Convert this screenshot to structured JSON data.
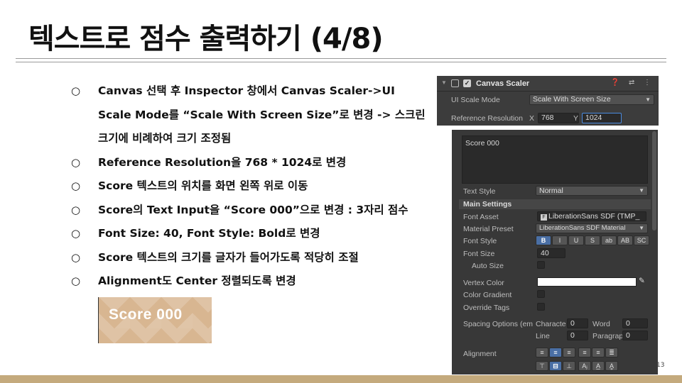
{
  "title": "텍스트로 점수 출력하기 (4/8)",
  "bullet_mark": "○",
  "bullets": [
    [
      "Canvas 선택 후 Inspector 창에서 Canvas Scaler->UI",
      "Scale Mode를 “Scale With Screen Size”로 변경 -> 스크린",
      "크기에 비례하여 크기 조정됨"
    ],
    [
      "Reference Resolution을 768 * 1024로 변경"
    ],
    [
      "Score 텍스트의 위치를 화면 왼쪽 위로 이동"
    ],
    [
      "Score의 Text Input을 “Score 000”으로 변경 : 3자리 점수"
    ],
    [
      "Font Size: 40, Font Style: Bold로 변경"
    ],
    [
      "Score 텍스트의 크기를 글자가 들어가도록 적당히 조절"
    ],
    [
      "Alignment도 Center 정렬되도록 변경"
    ]
  ],
  "preview": {
    "text": "Score 000",
    "bg_color": "#d9b895"
  },
  "canvas_scaler": {
    "name": "Canvas Scaler",
    "header_icons": "❓ ⇄ ⋮",
    "ui_scale_mode_label": "UI Scale Mode",
    "ui_scale_mode_value": "Scale With Screen Size",
    "ref_res_label": "Reference Resolution",
    "x_label": "X",
    "x_value": "768",
    "y_label": "Y",
    "y_value": "1024"
  },
  "tmp": {
    "text_input": "Score 000",
    "text_style_label": "Text Style",
    "text_style_value": "Normal",
    "main_settings": "Main Settings",
    "font_asset_label": "Font Asset",
    "font_asset_value": "LiberationSans SDF (TMP_",
    "material_preset_label": "Material Preset",
    "material_preset_value": "LiberationSans SDF Material",
    "font_style_label": "Font Style",
    "font_style_buttons": [
      "B",
      "I",
      "U",
      "S",
      "ab",
      "AB",
      "SC"
    ],
    "font_size_label": "Font Size",
    "font_size_value": "40",
    "auto_size_label": "Auto Size",
    "vertex_color_label": "Vertex Color",
    "color_gradient_label": "Color Gradient",
    "override_tags_label": "Override Tags",
    "spacing_label": "Spacing Options (em",
    "character_label": "Characte",
    "character_value": "0",
    "word_label": "Word",
    "word_value": "0",
    "line_label": "Line",
    "line_value": "0",
    "paragraph_label": "Paragrap",
    "paragraph_value": "0",
    "alignment_label": "Alignment",
    "align_row1": [
      "≡",
      "≡",
      "≡",
      "≡",
      "≡",
      "≣"
    ],
    "align_row2": [
      "⊤",
      "⊟",
      "⊥",
      "Aⱼ",
      "A̲",
      "A̳"
    ]
  },
  "page_number": "13",
  "colors": {
    "accent_footer": "#c4aa7d",
    "panel_bg": "#383838",
    "selection_blue": "#4a8be0"
  }
}
